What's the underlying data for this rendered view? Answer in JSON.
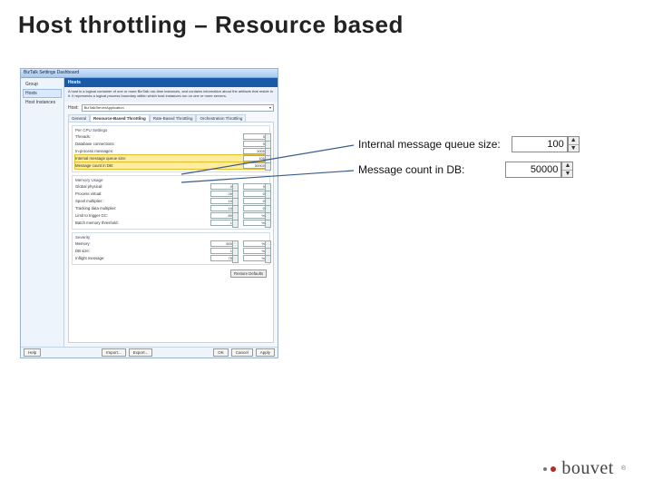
{
  "title": "Host throttling – Resource based",
  "dialog": {
    "windowTitle": "BizTalk Settings Dashboard",
    "nav": {
      "group": "Group",
      "hosts": "Hosts",
      "hostInstances": "Host Instances"
    },
    "banner": "Hosts",
    "description": "A host is a logical container of one or more BizTalk run-time instances, and contains information about the artifacts that reside in it. It represents a logical process boundary within which host instances run on one or more servers.",
    "hostLabel": "Host:",
    "hostValue": "BizTalkServerApplication",
    "tabs": {
      "general": "General",
      "resource": "Resource-Based Throttling",
      "rate": "Rate-Based Throttling",
      "orch": "Orchestration Throttling"
    },
    "groups": {
      "perCpu": {
        "title": "Per CPU Settings",
        "threads": {
          "label": "Threads:",
          "value": "0"
        },
        "dbConn": {
          "label": "Database connections:",
          "value": "0"
        },
        "inproc": {
          "label": "In-process messages:",
          "value": "1000"
        },
        "imq": {
          "label": "Internal message queue size:",
          "value": "100"
        },
        "mcdb": {
          "label": "Message count in DB:",
          "value": "50000"
        }
      },
      "memory": {
        "title": "Memory Usage",
        "global": {
          "label": "Global physical:",
          "value": "0",
          "pct": "0"
        },
        "process": {
          "label": "Process virtual:",
          "value": "25",
          "pct": "0"
        },
        "spool": {
          "label": "Spool multiplier:",
          "value": "10",
          "pct": "0"
        },
        "track": {
          "label": "Tracking data multiplier:",
          "value": "10",
          "pct": "0"
        },
        "gc": {
          "label": "Limit to trigger GC:",
          "value": "80",
          "pct": "%"
        },
        "batch": {
          "label": "Batch memory threshold:",
          "value": "1",
          "pct": "%"
        }
      },
      "severity": {
        "title": "Severity",
        "memory": {
          "label": "Memory:",
          "value": "500",
          "pct": "%"
        },
        "db": {
          "label": "DB size:",
          "value": "1",
          "pct": "%"
        },
        "inflight": {
          "label": "Inflight message:",
          "value": "75",
          "pct": "%"
        }
      }
    },
    "restore": "Restore Defaults",
    "bottom": {
      "help": "Help",
      "import": "Import...",
      "export": "Export...",
      "ok": "OK",
      "cancel": "Cancel",
      "apply": "Apply"
    }
  },
  "callouts": {
    "imq": {
      "label": "Internal message queue size:",
      "value": "100"
    },
    "mcdb": {
      "label": "Message count in DB:",
      "value": "50000"
    }
  },
  "logo": "bouvet"
}
